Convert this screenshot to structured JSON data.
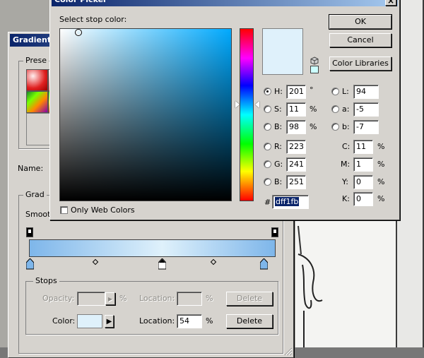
{
  "gradient_editor": {
    "title": "Gradient E",
    "presets_label": "Prese",
    "name_label": "Name:",
    "gradient_type_label": "Grad",
    "smoothness_label": "Smoot",
    "stops": {
      "title": "Stops",
      "opacity_label": "Opacity:",
      "opacity_unit": "%",
      "opacity_location_label": "Location:",
      "opacity_location_unit": "%",
      "opacity_delete": "Delete",
      "color_label": "Color:",
      "color_location_label": "Location:",
      "color_location_value": "54",
      "color_location_unit": "%",
      "color_delete": "Delete",
      "color_swatch": "#dff1fb"
    },
    "gradient_colors": [
      "#7eb6ea",
      "#dff1fb",
      "#7eb6ea"
    ]
  },
  "color_picker": {
    "title": "Color Picker",
    "close_glyph": "×",
    "select_label": "Select stop color:",
    "ok": "OK",
    "cancel": "Cancel",
    "color_libraries": "Color Libraries",
    "only_web_colors": "Only Web Colors",
    "hex_prefix": "#",
    "hex_value": "dff1fb",
    "swatch_color": "#dff1fb",
    "field_hue_color": "#00aaff",
    "hsb": [
      {
        "label": "H:",
        "value": "201",
        "unit": "°",
        "selected": true
      },
      {
        "label": "S:",
        "value": "11",
        "unit": "%",
        "selected": false
      },
      {
        "label": "B:",
        "value": "98",
        "unit": "%",
        "selected": false
      }
    ],
    "rgb": [
      {
        "label": "R:",
        "value": "223"
      },
      {
        "label": "G:",
        "value": "241"
      },
      {
        "label": "B:",
        "value": "251"
      }
    ],
    "lab": [
      {
        "label": "L:",
        "value": "94"
      },
      {
        "label": "a:",
        "value": "-5"
      },
      {
        "label": "b:",
        "value": "-7"
      }
    ],
    "cmyk": [
      {
        "label": "C:",
        "value": "11",
        "unit": "%"
      },
      {
        "label": "M:",
        "value": "1",
        "unit": "%"
      },
      {
        "label": "Y:",
        "value": "0",
        "unit": "%"
      },
      {
        "label": "K:",
        "value": "0",
        "unit": "%"
      }
    ]
  }
}
